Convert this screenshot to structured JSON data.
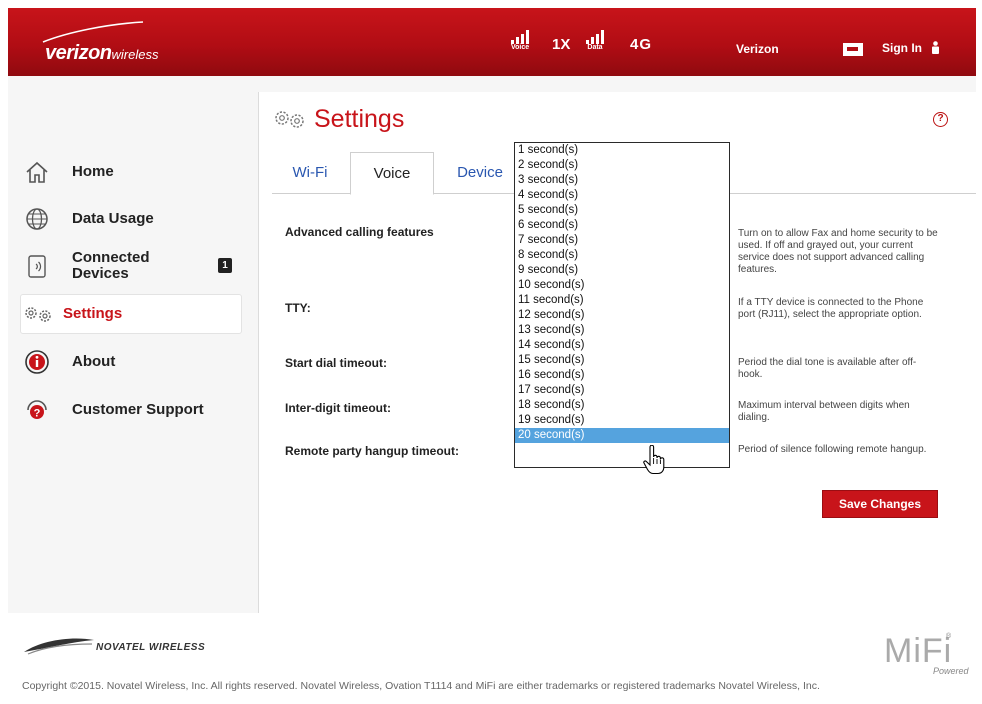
{
  "header": {
    "brand_main": "verizon",
    "brand_sub": "wireless",
    "signal_voice_label": "Voice",
    "network_1x": "1X",
    "signal_data_label": "Data",
    "network_4g": "4G",
    "carrier": "Verizon",
    "sign_in": "Sign In"
  },
  "sidebar": {
    "items": [
      {
        "label": "Home",
        "icon": "home-icon"
      },
      {
        "label": "Data Usage",
        "icon": "globe-icon"
      },
      {
        "label": "Connected Devices",
        "icon": "devices-icon",
        "badge": "1"
      },
      {
        "label": "Settings",
        "icon": "gears-icon",
        "active": true
      },
      {
        "label": "About",
        "icon": "info-icon"
      },
      {
        "label": "Customer Support",
        "icon": "support-icon"
      }
    ]
  },
  "page": {
    "title": "Settings",
    "help_icon": "?"
  },
  "tabs": [
    {
      "label": "Wi-Fi"
    },
    {
      "label": "Voice",
      "active": true
    },
    {
      "label": "Device"
    }
  ],
  "rows": [
    {
      "label": "Advanced calling features",
      "help": "Turn on to allow Fax and home security to be used. If off and grayed out, your current service does not support advanced calling features."
    },
    {
      "label": "TTY:",
      "help": "If a TTY device is connected to the Phone port (RJ11), select the appropriate option."
    },
    {
      "label": "Start dial timeout:",
      "help": "Period the dial tone is available after off-hook."
    },
    {
      "label": "Inter-digit timeout:",
      "help": "Maximum interval between digits when dialing."
    },
    {
      "label": "Remote party hangup timeout:",
      "help": "Period of silence following remote hangup."
    }
  ],
  "dropdown": {
    "options": [
      "1 second(s)",
      "2 second(s)",
      "3 second(s)",
      "4 second(s)",
      "5 second(s)",
      "6 second(s)",
      "7 second(s)",
      "8 second(s)",
      "9 second(s)",
      "10 second(s)",
      "11 second(s)",
      "12 second(s)",
      "13 second(s)",
      "14 second(s)",
      "15 second(s)",
      "16 second(s)",
      "17 second(s)",
      "18 second(s)",
      "19 second(s)",
      "20 second(s)"
    ],
    "selected": "20 second(s)"
  },
  "actions": {
    "save": "Save Changes"
  },
  "footer": {
    "company": "NOVATEL WIRELESS",
    "copyright": "Copyright ©2015. Novatel Wireless, Inc. All rights reserved. Novatel Wireless, Ovation T1114 and MiFi are either trademarks or registered trademarks Novatel Wireless, Inc.",
    "mifi": "MiFi",
    "mifi_reg": "®",
    "mifi_powered": "Powered"
  },
  "colors": {
    "brand_red": "#c8141a",
    "link_blue": "#2a57b0",
    "selection_blue": "#55a3de"
  }
}
